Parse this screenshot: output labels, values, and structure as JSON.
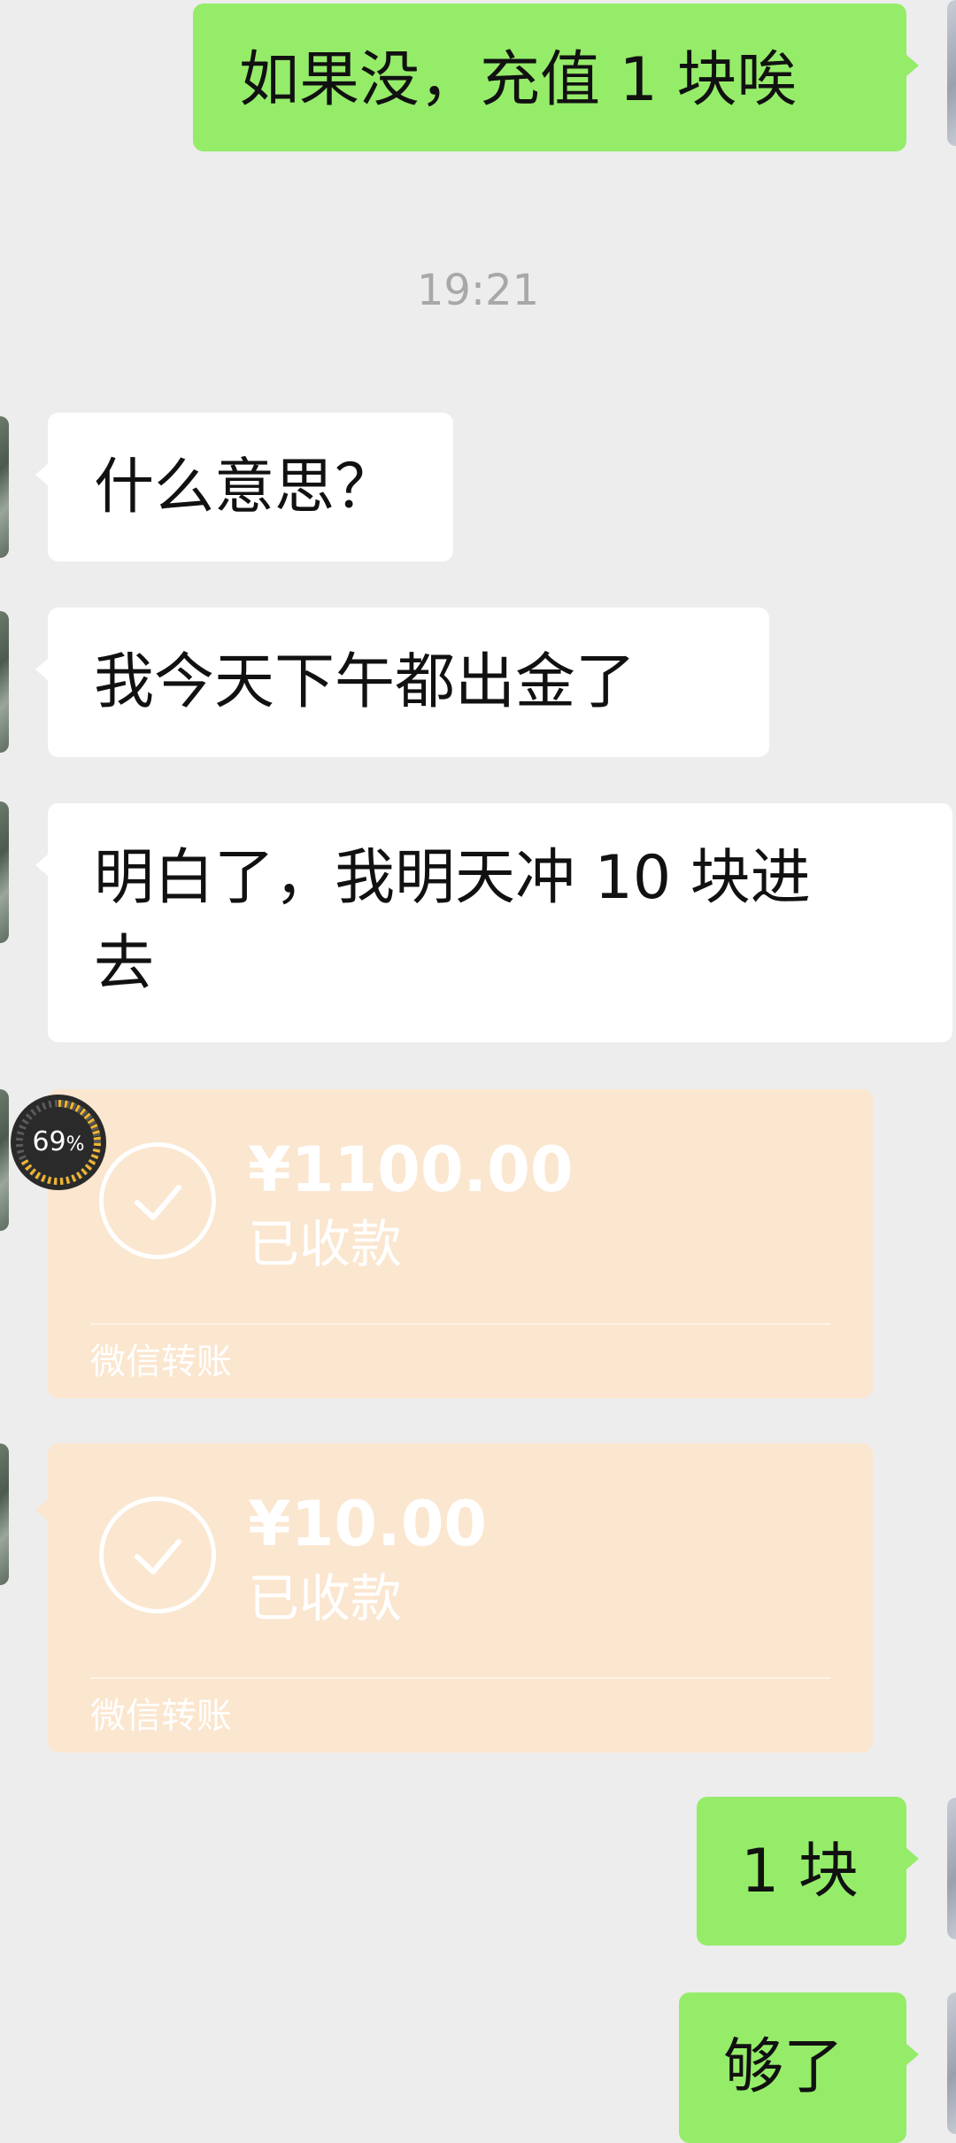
{
  "chat": {
    "messages": [
      {
        "direction": "outgoing",
        "text": "如果没，充值 1 块唉"
      },
      {
        "direction": "incoming",
        "text": "什么意思？"
      },
      {
        "direction": "incoming",
        "text": "我今天下午都出金了"
      },
      {
        "direction": "incoming",
        "lines": [
          "明白了，我明天冲 10 块进",
          "去"
        ]
      },
      {
        "direction": "outgoing",
        "text": "1 块"
      },
      {
        "direction": "outgoing",
        "text": "够了"
      }
    ],
    "timestamp": "19:21"
  },
  "transfers": [
    {
      "amount": "¥1100.00",
      "status": "已收款",
      "footer": "微信转账"
    },
    {
      "amount": "¥10.00",
      "status": "已收款",
      "footer": "微信转账"
    }
  ],
  "progress_badge": {
    "value": "69",
    "unit": "%",
    "fraction": 0.69
  },
  "colors": {
    "background": "#ededed",
    "incoming_bubble": "#ffffff",
    "outgoing_bubble": "#95ec69",
    "transfer_card": "#fbe6cf",
    "timestamp_text": "#a8a8a8"
  },
  "icons": [
    "check-circle-icon",
    "avatar"
  ]
}
